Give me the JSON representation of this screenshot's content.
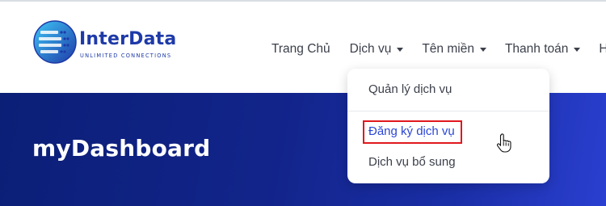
{
  "logo": {
    "name": "InterData",
    "tagline": "UNLIMITED CONNECTIONS"
  },
  "nav": {
    "items": [
      {
        "label": "Trang Chủ",
        "has_dropdown": false
      },
      {
        "label": "Dịch vụ",
        "has_dropdown": true
      },
      {
        "label": "Tên miền",
        "has_dropdown": true
      },
      {
        "label": "Thanh toán",
        "has_dropdown": true
      },
      {
        "label": "Hỗ",
        "has_dropdown": false
      }
    ]
  },
  "dropdown": {
    "items": [
      {
        "label": "Quản lý dịch vụ"
      },
      {
        "label": "Đăng ký dịch vụ",
        "highlighted": true
      },
      {
        "label": "Dịch vụ bổ sung"
      }
    ]
  },
  "banner": {
    "title": "myDashboard"
  },
  "colors": {
    "brand": "#1e3aa8",
    "banner": "#12248a",
    "link_active": "#2b46d6",
    "highlight_box": "#e0181e"
  },
  "icons": {
    "logo": "globe-icon",
    "caret": "chevron-down-icon",
    "cursor": "hand-pointer-icon"
  }
}
